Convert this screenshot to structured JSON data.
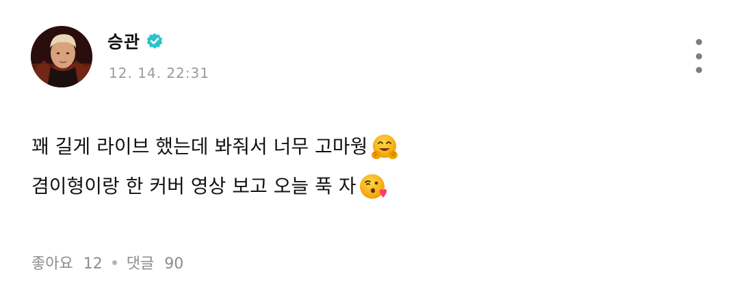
{
  "post": {
    "author": {
      "name": "승관",
      "verified": true,
      "avatar_icon": "avatar"
    },
    "timestamp": "12. 14. 22:31",
    "body": {
      "lines": [
        {
          "text": "꽤 길게 라이브 했는데 봐줘서 너무 고마웡",
          "emoji": "hugging-face-emoji"
        },
        {
          "text": "겸이형이랑 한 커버 영상 보고 오늘 푹 자",
          "emoji": "face-blowing-kiss-emoji"
        }
      ]
    },
    "footer": {
      "likes_label": "좋아요",
      "likes_count": "12",
      "comments_label": "댓글",
      "comments_count": "90"
    },
    "colors": {
      "verified": "#2bc3c9",
      "meta_text": "#9a9a9a",
      "menu_dots": "#7d7d7d"
    },
    "icons": {
      "menu": "more-vertical-icon",
      "verified": "verified-badge-icon"
    }
  }
}
